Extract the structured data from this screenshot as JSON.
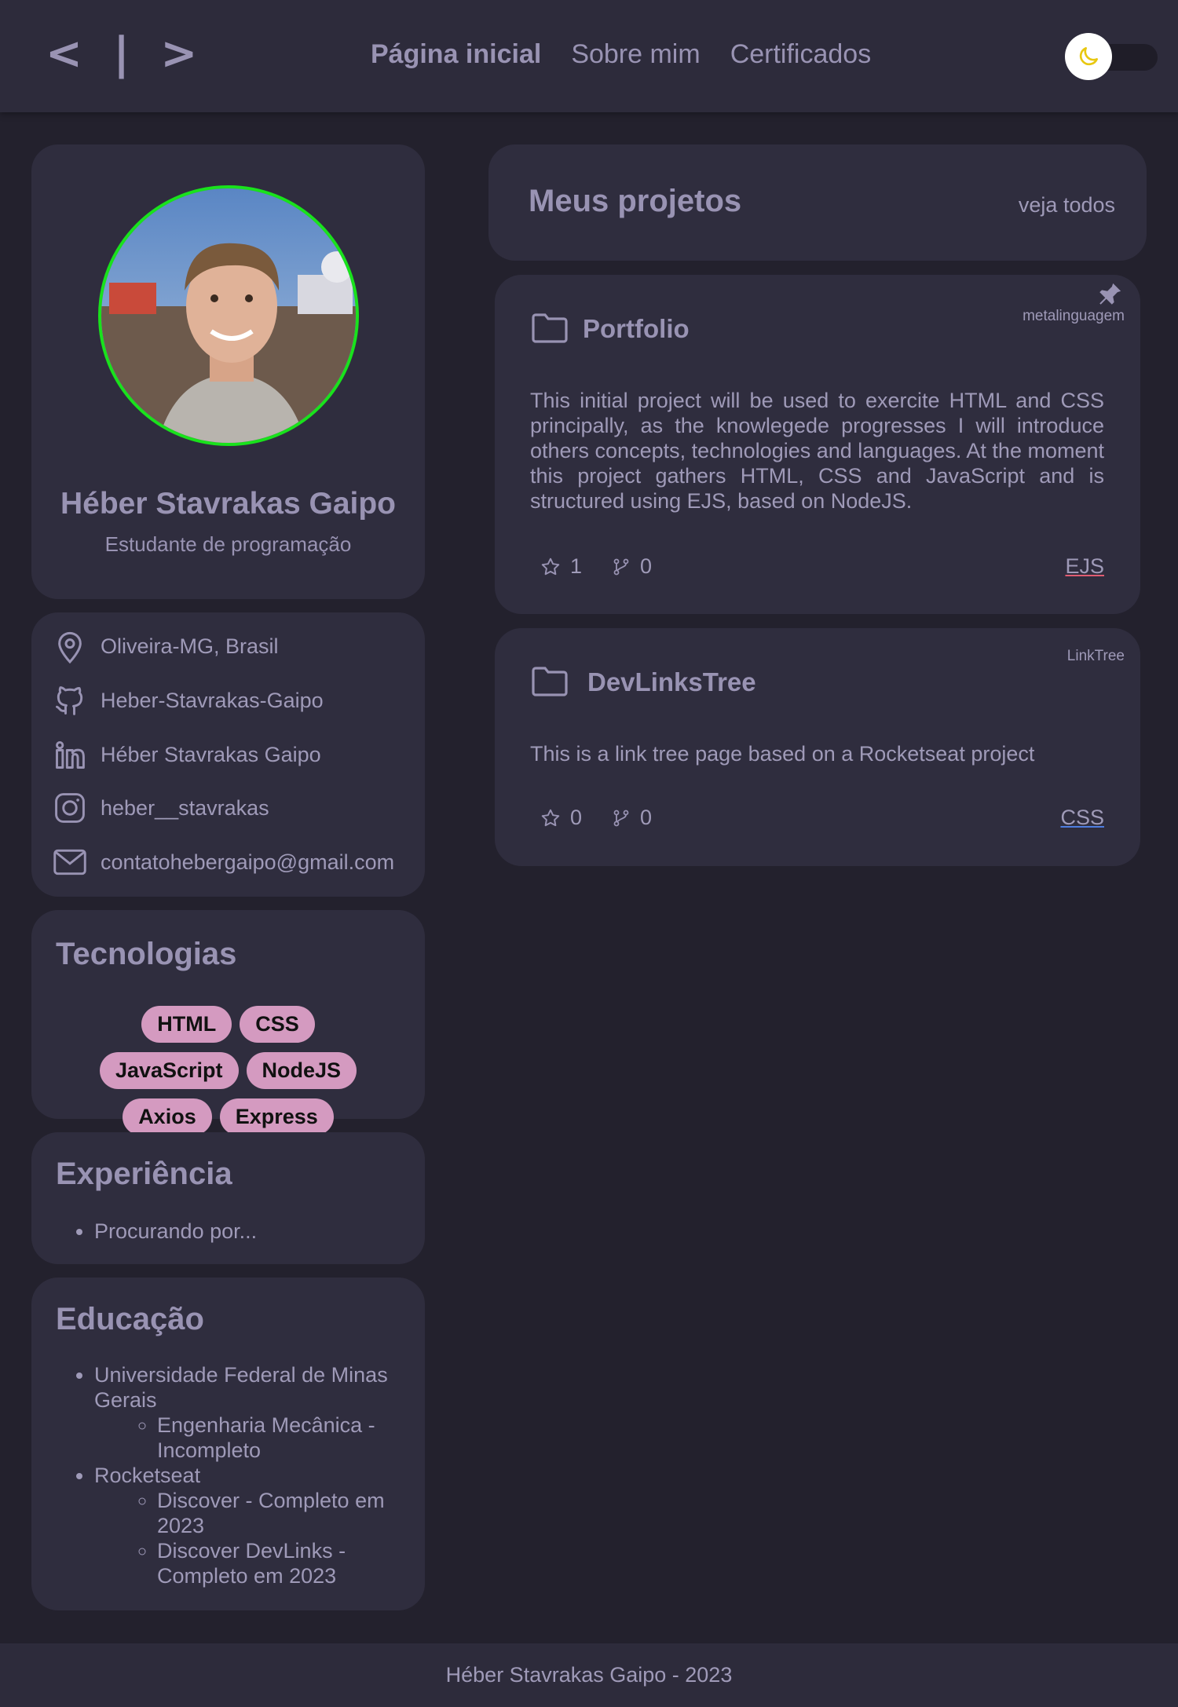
{
  "header": {
    "logo": "< | >",
    "nav": [
      "Página inicial",
      "Sobre mim",
      "Certificados"
    ],
    "theme_toggle_icon": "moon-icon"
  },
  "profile": {
    "name": "Héber Stavrakas Gaipo",
    "role": "Estudante de programação",
    "avatar": "profile-photo"
  },
  "contacts": {
    "location": "Oliveira-MG, Brasil",
    "github": "Heber-Stavrakas-Gaipo",
    "linkedin": "Héber Stavrakas Gaipo",
    "instagram": "heber__stavrakas",
    "email": "contatohebergaipo@gmail.com"
  },
  "technologies": {
    "title": "Tecnologias",
    "tags": [
      "HTML",
      "CSS",
      "JavaScript",
      "NodeJS",
      "Axios",
      "Express"
    ]
  },
  "experience": {
    "title": "Experiência",
    "items": [
      "Procurando por..."
    ]
  },
  "education": {
    "title": "Educação",
    "items": [
      {
        "label": "Universidade Federal de Minas Gerais",
        "sub": [
          "Engenharia Mecânica - Incompleto"
        ]
      },
      {
        "label": "Rocketseat",
        "sub": [
          "Discover - Completo em 2023",
          "Discover DevLinks - Completo em 2023"
        ]
      }
    ]
  },
  "projects": {
    "title": "Meus projetos",
    "see_all": "veja todos",
    "items": [
      {
        "name": "Portfolio",
        "topic": "metalinguagem",
        "pinned": true,
        "description": "This initial project will be used to exercite HTML and CSS principally, as the knowlegede progresses I will introduce others concepts, technologies and languages. At the moment this project gathers HTML, CSS and JavaScript and is structured using EJS, based on NodeJS.",
        "stars": "1",
        "forks": "0",
        "language": "EJS",
        "language_color": "#e05d72"
      },
      {
        "name": "DevLinksTree",
        "topic": "LinkTree",
        "pinned": false,
        "description": "This is a link tree page based on a Rocketseat project",
        "stars": "0",
        "forks": "0",
        "language": "CSS",
        "language_color": "#4e7de0"
      }
    ]
  },
  "footer": {
    "text": "Héber Stavrakas Gaipo - 2023"
  },
  "colors": {
    "background": "#23212d",
    "card": "#2f2d3e",
    "accent_text": "#9993b3",
    "tag": "#d49ac0",
    "avatar_ring": "#19e21c"
  }
}
